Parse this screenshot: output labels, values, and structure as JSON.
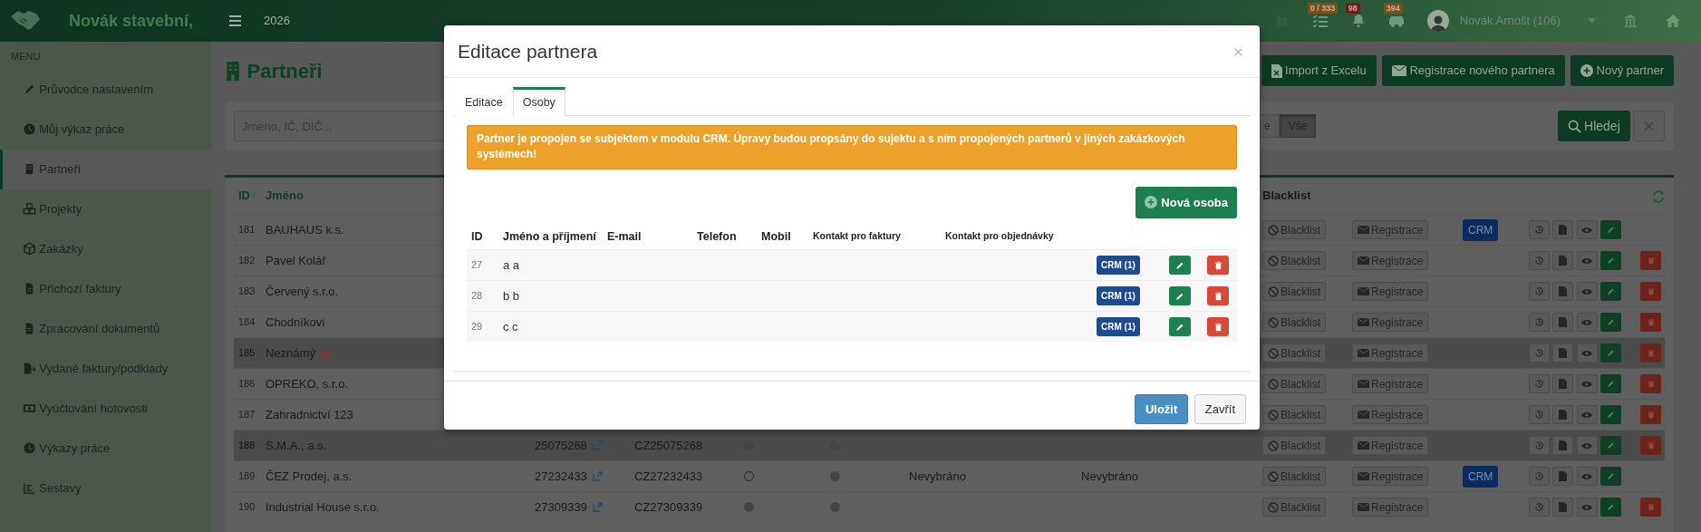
{
  "app_bar": {
    "brand": "Novák stavební,",
    "year": "2026",
    "badges": [
      {
        "text": "0 / 333",
        "color": "#7a5218"
      },
      {
        "text": "98",
        "color": "#6e1f1a"
      },
      {
        "text": "394",
        "color": "#7a5218"
      }
    ],
    "user": "Novák Arnošt (106)"
  },
  "sidebar": {
    "heading": "MENU",
    "items": [
      {
        "label": "Průvodce nastavením",
        "selected": false
      },
      {
        "label": "Můj výkaz práce",
        "selected": false
      },
      {
        "label": "Partneři",
        "selected": true
      },
      {
        "label": "Projekty",
        "selected": false
      },
      {
        "label": "Zakázky",
        "selected": false
      },
      {
        "label": "Příchozí faktury",
        "selected": false
      },
      {
        "label": "Zpracování dokumentů",
        "selected": false
      },
      {
        "label": "Vydané faktury/podklady",
        "selected": false
      },
      {
        "label": "Vyúčtování hotovosti",
        "selected": false
      },
      {
        "label": "Výkazy práce",
        "selected": false
      },
      {
        "label": "Sestavy",
        "selected": false
      }
    ]
  },
  "page": {
    "title": "Partneři",
    "buttons": [
      "Import z Excelu",
      "Registrace nového partnera",
      "Nový partner"
    ]
  },
  "search": {
    "placeholder": "Jméno, IČ, DIČ...",
    "filters": [
      {
        "label": "e",
        "selected": false
      },
      {
        "label": "Vše",
        "selected": true
      }
    ],
    "search_button": "Hledej"
  },
  "table": {
    "headers": {
      "id": "ID",
      "name": "Jméno",
      "blacklist": "Blacklist"
    },
    "rows": [
      {
        "id": "181",
        "name": "BAUHAUS k.s.",
        "warning": false,
        "highlighted": false,
        "blacklist": "Blacklist",
        "registration": "Registrace",
        "crm": "CRM",
        "deletable": false
      },
      {
        "id": "182",
        "name": "Pavel Kolář",
        "warning": false,
        "highlighted": false,
        "blacklist": "Blacklist",
        "registration": "Registrace",
        "deletable": true
      },
      {
        "id": "183",
        "name": "Červený s.r.o.",
        "warning": false,
        "highlighted": false,
        "blacklist": "Blacklist",
        "registration": "Registrace",
        "deletable": true
      },
      {
        "id": "184",
        "name": "Chodníkovi",
        "warning": false,
        "highlighted": false,
        "blacklist": "Blacklist",
        "registration": "Registrace",
        "deletable": true
      },
      {
        "id": "185",
        "name": "Neznámý",
        "warning": true,
        "highlighted": true,
        "blacklist": "Blacklist",
        "registration": "Registrace",
        "deletable": true
      },
      {
        "id": "186",
        "name": "OPREKO, s.r.o.",
        "warning": false,
        "highlighted": false,
        "blacklist": "Blacklist",
        "registration": "Registrace",
        "deletable": true
      },
      {
        "id": "187",
        "name": "Zahradnictví 123",
        "warning": false,
        "highlighted": false,
        "blacklist": "Blacklist",
        "registration": "Registrace",
        "deletable": true
      },
      {
        "id": "188",
        "name": "S.M.A., a.s.",
        "warning": false,
        "highlighted": true,
        "ic": "25075268",
        "dic": "CZ25075268",
        "flag_1": true,
        "flag_2": true,
        "blacklist": "Blacklist",
        "registration": "Registrace",
        "deletable": true
      },
      {
        "id": "189",
        "name": "ČEZ Prodej, a.s.",
        "warning": false,
        "highlighted": false,
        "ic": "27232433",
        "dic": "CZ27232433",
        "flag_1": false,
        "flag_2": true,
        "column_7": "Nevybráno",
        "column_8": "Nevybráno",
        "blacklist": "Blacklist",
        "registration": "Registrace",
        "crm": "CRM",
        "deletable": false
      },
      {
        "id": "190",
        "name": "Industrial House s.r.o.",
        "warning": false,
        "highlighted": false,
        "ic": "27309339",
        "dic": "CZ27309339",
        "flag_1": true,
        "flag_2": true,
        "blacklist": "Blacklist",
        "registration": "Registrace",
        "deletable": true
      }
    ]
  },
  "dialog": {
    "title": "Editace partnera",
    "tabs": [
      {
        "label": "Editace",
        "selected": false
      },
      {
        "label": "Osoby",
        "selected": true
      }
    ],
    "alert": "Partner je propojen se subjektem v modulu CRM. Úpravy budou propsány do sujektu a s ním propojených partnerů v jiných zakázkových systémech!",
    "new_button": "Nová osoba",
    "columns": [
      "ID",
      "Jméno a příjmení",
      "E-mail",
      "Telefon",
      "Mobil",
      "Kontakt pro faktury",
      "Kontakt pro objednávky"
    ],
    "rows": [
      {
        "id": "27",
        "name": "a a",
        "crm": "CRM (1)"
      },
      {
        "id": "28",
        "name": "b b",
        "crm": "CRM (1)"
      },
      {
        "id": "29",
        "name": "c c",
        "crm": "CRM (1)"
      }
    ],
    "buttons": [
      {
        "label": "Uložit",
        "kind": "primary"
      },
      {
        "label": "Zavřít",
        "kind": "secondary"
      }
    ]
  }
}
